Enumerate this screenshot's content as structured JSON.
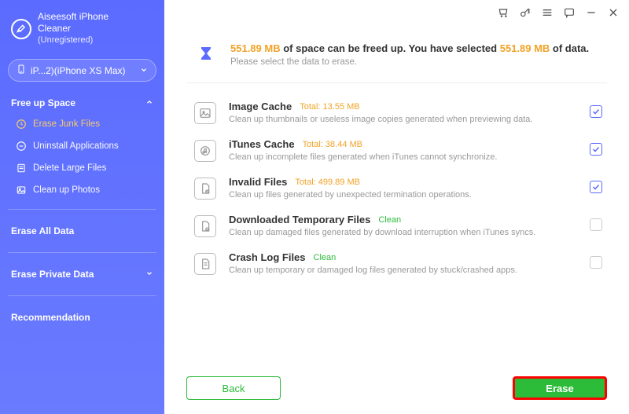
{
  "brand": {
    "title": "Aiseesoft iPhone",
    "subtitle": "Cleaner",
    "status": "(Unregistered)"
  },
  "device": {
    "label": "iP...2)(iPhone XS Max)"
  },
  "sidebar": {
    "section_free": "Free up Space",
    "items": {
      "junk": "Erase Junk Files",
      "uninstall": "Uninstall Applications",
      "large": "Delete Large Files",
      "photos": "Clean up Photos"
    },
    "erase_all": "Erase All Data",
    "erase_private": "Erase Private Data",
    "recommendation": "Recommendation"
  },
  "summary": {
    "free_amount": "551.89 MB",
    "line1_mid": " of space can be freed up. You have selected ",
    "selected_amount": "551.89 MB",
    "line1_end": " of data.",
    "sub": "Please select the data to erase."
  },
  "rows": {
    "image_cache": {
      "title": "Image Cache",
      "total": "Total: 13.55 MB",
      "desc": "Clean up thumbnails or useless image copies generated when previewing data."
    },
    "itunes_cache": {
      "title": "iTunes Cache",
      "total": "Total: 38.44 MB",
      "desc": "Clean up incomplete files generated when iTunes cannot synchronize."
    },
    "invalid": {
      "title": "Invalid Files",
      "total": "Total: 499.89 MB",
      "desc": "Clean up files generated by unexpected termination operations."
    },
    "downloaded": {
      "title": "Downloaded Temporary Files",
      "total": "Clean",
      "desc": "Clean up damaged files generated by download interruption when iTunes syncs."
    },
    "crash": {
      "title": "Crash Log Files",
      "total": "Clean",
      "desc": "Clean up temporary or damaged log files generated by stuck/crashed apps."
    }
  },
  "footer": {
    "back": "Back",
    "erase": "Erase"
  }
}
